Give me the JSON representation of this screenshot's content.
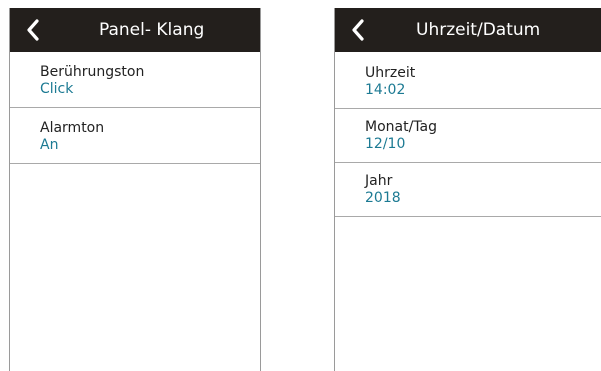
{
  "panels": [
    {
      "title": "Panel- Klang",
      "items": [
        {
          "label": "Berührungston",
          "value": "Click"
        },
        {
          "label": "Alarmton",
          "value": "An"
        }
      ]
    },
    {
      "title": "Uhrzeit/Datum",
      "items": [
        {
          "label": "Uhrzeit",
          "value": "14:02"
        },
        {
          "label": "Monat/Tag",
          "value": "12/10"
        },
        {
          "label": "Jahr",
          "value": "2018"
        }
      ]
    }
  ],
  "icons": {
    "back": "chevron-left-icon"
  },
  "colors": {
    "header_bg": "#231f1c",
    "value_text": "#1c7a93",
    "divider": "#a9a9a9"
  }
}
